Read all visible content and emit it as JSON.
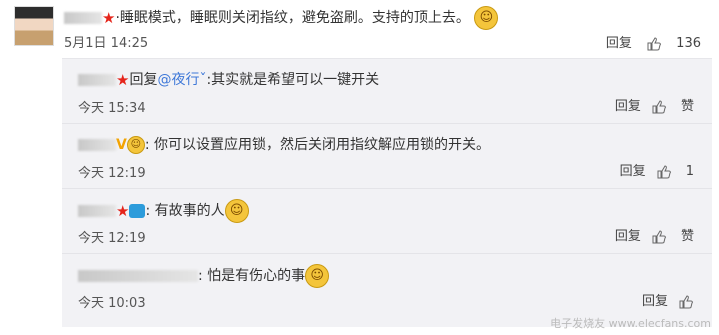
{
  "comment": {
    "suffix": "·",
    "text": "睡眠模式，睡眠则关闭指纹，避免盗刷。支持的顶上去。",
    "time": "5月1日 14:25",
    "reply_label": "回复",
    "likes": "136"
  },
  "replies": [
    {
      "reply_prefix": "回复",
      "mention": "@夜行ˇ",
      "text": ":其实就是希望可以一键开关",
      "time": "今天 15:34",
      "reply_label": "回复",
      "like_label": "赞"
    },
    {
      "badge": "V",
      "text": ": 你可以设置应用锁，然后关闭用指纹解应用锁的开关。",
      "time": "今天 12:19",
      "reply_label": "回复",
      "likes": "1"
    },
    {
      "text": ": 有故事的人",
      "time": "今天 12:19",
      "reply_label": "回复",
      "like_label": "赞"
    },
    {
      "text": ": 怕是有伤心的事",
      "time": "今天 10:03",
      "reply_label": "回复",
      "like_label": ""
    }
  ],
  "watermark": "电子发烧友 www.elecfans.com",
  "icons": [
    "star-icon",
    "emoji-icon",
    "thumb-icon",
    "camera-icon",
    "avatar"
  ]
}
